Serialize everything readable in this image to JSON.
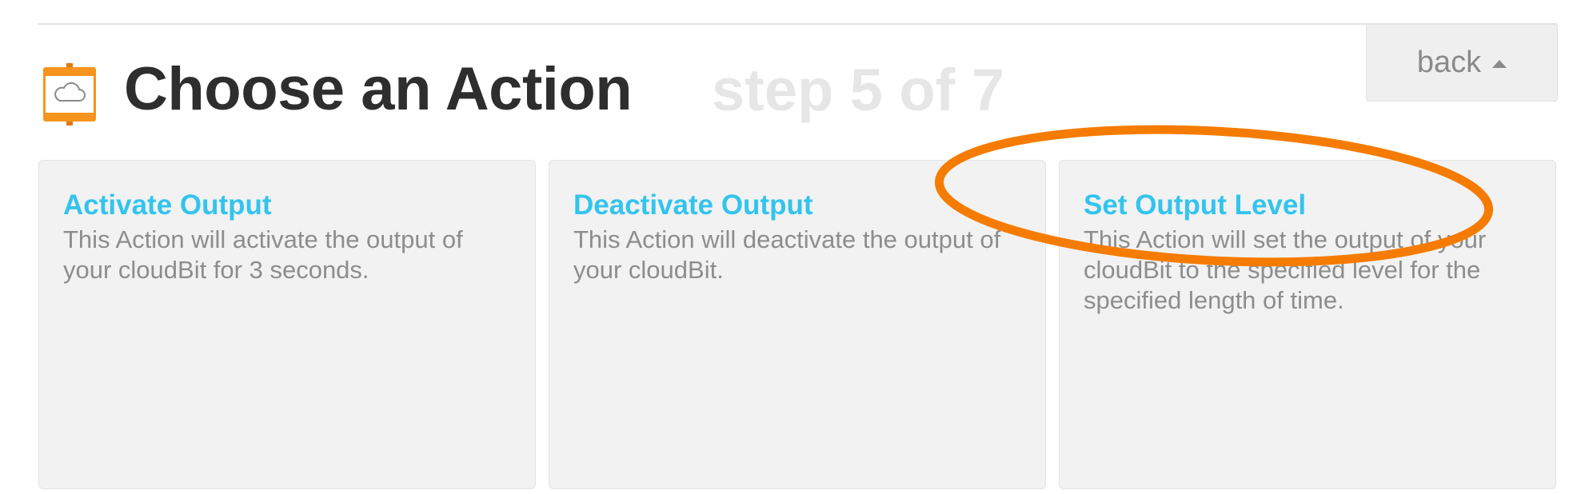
{
  "header": {
    "title": "Choose an Action",
    "step": "step 5 of 7",
    "back_label": "back"
  },
  "actions": [
    {
      "title": "Activate Output",
      "description": "This Action will activate the output of your cloudBit for 3 seconds."
    },
    {
      "title": "Deactivate Output",
      "description": "This Action will deactivate the output of your cloudBit."
    },
    {
      "title": "Set Output Level",
      "description": "This Action will set the output of your cloudBit to the specified level for the specified length of time."
    }
  ],
  "colors": {
    "accent": "#33c4ee",
    "title": "#2e2e2e",
    "step": "#e6e6e6",
    "annotation": "#f57c00",
    "brand": "#f7941d"
  },
  "icons": {
    "service": "cloudbit-icon",
    "back": "caret-up-icon"
  }
}
